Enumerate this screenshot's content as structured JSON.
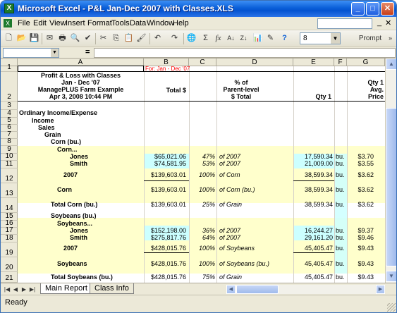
{
  "window": {
    "title": "Microsoft Excel - P&L Jan-Dec 2007 with Classes.XLS",
    "app_icon": "excel-icon"
  },
  "title_buttons": {
    "minimize": "_",
    "maximize": "□",
    "close": "✕"
  },
  "menu": {
    "items": [
      "File",
      "Edit",
      "View",
      "Insert",
      "Format",
      "Tools",
      "Data",
      "Window",
      "Help"
    ],
    "help_placeholder": ""
  },
  "toolbar": {
    "icons": [
      "new-icon",
      "open-icon",
      "save-icon",
      "permission-icon",
      "print-icon",
      "print-preview-icon",
      "spelling-icon",
      "cut-icon",
      "copy-icon",
      "paste-icon",
      "format-painter-icon",
      "undo-icon",
      "redo-icon",
      "hyperlink-icon",
      "autosum-icon",
      "function-icon",
      "sort-ascending-icon",
      "sort-descending-icon",
      "chart-icon",
      "drawing-icon",
      "help-icon"
    ],
    "glyphs": [
      "🗋",
      "📂",
      "💾",
      "✉",
      "🖶",
      "🔍",
      "✔",
      "✂",
      "⎘",
      "📋",
      "🖌",
      "↶",
      "↷",
      "🌐",
      "Σ",
      "fx",
      "A↓",
      "Z↓",
      "📊",
      "✎",
      "?"
    ],
    "zoom_value": "8",
    "prompt_label": "Prompt"
  },
  "formula_bar": {
    "fx_label": "=",
    "value": ""
  },
  "columns": [
    "A",
    "B",
    "C",
    "D",
    "E",
    "F",
    "G"
  ],
  "rows": {
    "numbers": [
      "1",
      "2",
      "3",
      "4",
      "5",
      "6",
      "7",
      "8",
      "9",
      "10",
      "11",
      "12",
      "13",
      "14",
      "15",
      "16",
      "17",
      "18",
      "19",
      "20",
      "21"
    ],
    "r1_note": "For:  Jan - Dec '07",
    "header": {
      "a1": "Profit & Loss with Classes",
      "a2": "Jan - Dec '07",
      "a3": "ManagePLUS Farm Example",
      "a4": "Apr 3, 2008   10:44 PM",
      "total": "Total $",
      "pct1": "% of",
      "pct2": "Parent-level",
      "pct3": "$ Total",
      "qty": "Qty 1",
      "g1": "Qty 1",
      "g2": "Avg.",
      "g3": "Price"
    },
    "r4": "Ordinary Income/Expense",
    "r5": "Income",
    "r6": "Sales",
    "r7": "Grain",
    "r8": "Corn (bu.)",
    "r9": "Corn...",
    "r10": {
      "a": "Jones",
      "b": "$65,021.06",
      "c": "47%",
      "d": "of 2007",
      "e": "17,590.34",
      "f": "bu.",
      "g": "$3.70"
    },
    "r11": {
      "a": "Smith",
      "b": "$74,581.95",
      "c": "53%",
      "d": "of 2007",
      "e": "21,009.00",
      "f": "bu.",
      "g": "$3.55"
    },
    "r12": {
      "a": "2007",
      "b": "$139,603.01",
      "c": "100%",
      "d": "of Corn",
      "e": "38,599.34",
      "f": "bu.",
      "g": "$3.62"
    },
    "r13": {
      "a": "Corn",
      "b": "$139,603.01",
      "c": "100%",
      "d": "of Corn (bu.)",
      "e": "38,599.34",
      "f": "bu.",
      "g": "$3.62"
    },
    "r14": {
      "a": "Total Corn (bu.)",
      "b": "$139,603.01",
      "c": "25%",
      "d": "of Grain",
      "e": "38,599.34",
      "f": "bu.",
      "g": "$3.62"
    },
    "r15": "Soybeans (bu.)",
    "r16": "Soybeans...",
    "r17": {
      "a": "Jones",
      "b": "$152,198.00",
      "c": "36%",
      "d": "of 2007",
      "e": "16,244.27",
      "f": "bu.",
      "g": "$9.37"
    },
    "r18": {
      "a": "Smith",
      "b": "$275,817.76",
      "c": "64%",
      "d": "of 2007",
      "e": "29,161.20",
      "f": "bu.",
      "g": "$9.46"
    },
    "r19": {
      "a": "2007",
      "b": "$428,015.76",
      "c": "100%",
      "d": "of Soybeans",
      "e": "45,405.47",
      "f": "bu.",
      "g": "$9.43"
    },
    "r20": {
      "a": "Soybeans",
      "b": "$428,015.76",
      "c": "100%",
      "d": "of Soybeans (bu.)",
      "e": "45,405.47",
      "f": "bu.",
      "g": "$9.43"
    },
    "r21": {
      "a": "Total Soybeans (bu.)",
      "b": "$428,015.76",
      "c": "75%",
      "d": "of Grain",
      "e": "45,405.47",
      "f": "bu.",
      "g": "$9.43"
    }
  },
  "sheets": {
    "active": "Main Report",
    "other": "Class Info"
  },
  "status": "Ready",
  "colors": {
    "yellow_band": "#ffffcc",
    "blue_cell": "#ccffff",
    "red_note": "#ff0000"
  }
}
